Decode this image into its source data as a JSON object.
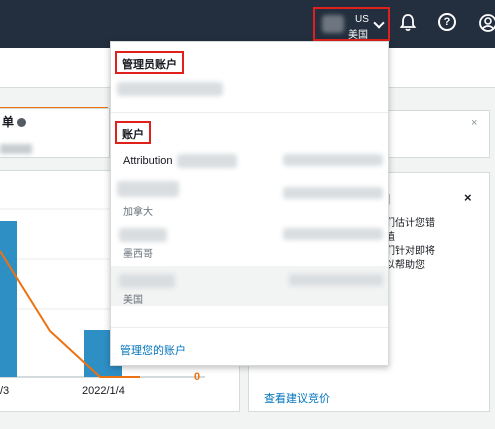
{
  "topbar": {
    "account_code": "US",
    "account_region": "美国",
    "icons": [
      "bell-icon",
      "help-icon",
      "user-icon"
    ],
    "help_glyph": "?"
  },
  "background": {
    "panel_title": "单",
    "close_glyph": "×",
    "chart": {
      "tick_labels": [
        "/3",
        "2022/1/4"
      ],
      "zero_label": "0",
      "bar_color": "#2e8fc5",
      "line_color": "#ec7211"
    },
    "recommendation": {
      "title": "]",
      "close_glyph": "×",
      "text": "们估计您错\n值\n们针对即将\n以帮助您",
      "link": "查看建议竞价"
    }
  },
  "dropdown": {
    "admin_header": "管理员账户",
    "accounts_header": "账户",
    "attribution_text": "Attribution",
    "accounts": [
      {
        "label": "加拿大",
        "selected": false
      },
      {
        "label": "墨西哥",
        "selected": false
      },
      {
        "label": "美国",
        "selected": true
      }
    ],
    "manage_link": "管理您的账户"
  },
  "colors": {
    "topbar": "#232f3e",
    "highlight": "#e0201b",
    "link": "#0073bb",
    "accent": "#ec7211"
  }
}
